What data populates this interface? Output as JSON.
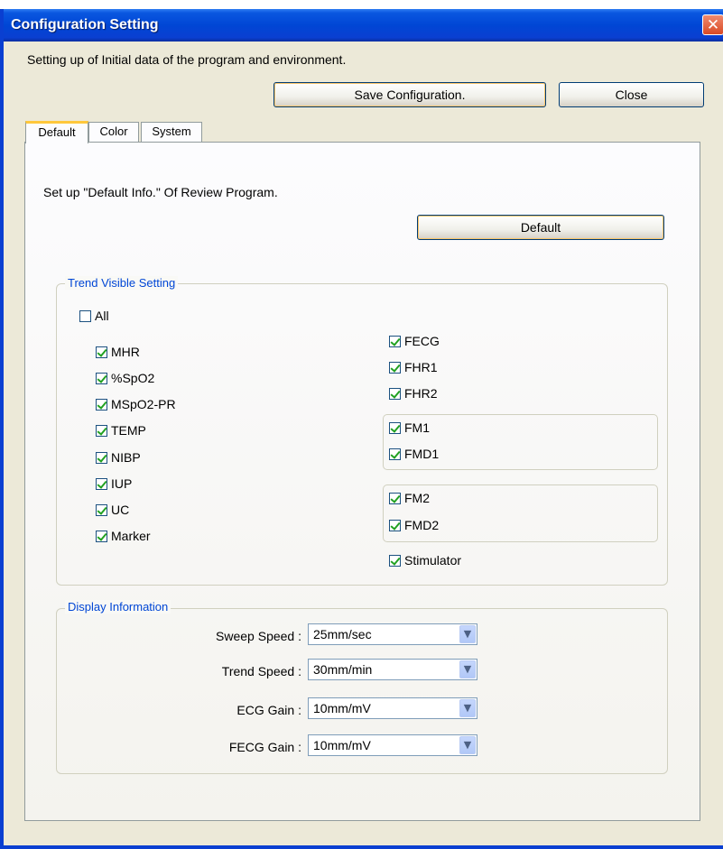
{
  "window": {
    "title": "Configuration Setting",
    "close_glyph": "✕"
  },
  "header": {
    "description": "Setting up of Initial data of the program and environment.",
    "save_label": "Save Configuration.",
    "close_label": "Close"
  },
  "tabs": [
    {
      "label": "Default",
      "selected": true
    },
    {
      "label": "Color",
      "selected": false
    },
    {
      "label": "System",
      "selected": false
    }
  ],
  "panel": {
    "description": "Set up \"Default Info.\" Of Review Program.",
    "default_button": "Default"
  },
  "trend": {
    "title": "Trend Visible Setting",
    "all": {
      "label": "All",
      "checked": false
    },
    "left": [
      {
        "label": "MHR",
        "checked": true
      },
      {
        "label": "%SpO2",
        "checked": true
      },
      {
        "label": "MSpO2-PR",
        "checked": true
      },
      {
        "label": "TEMP",
        "checked": true
      },
      {
        "label": "NIBP",
        "checked": true
      },
      {
        "label": "IUP",
        "checked": true
      },
      {
        "label": "UC",
        "checked": true
      },
      {
        "label": "Marker",
        "checked": true
      }
    ],
    "right": [
      {
        "label": "FECG",
        "checked": true
      },
      {
        "label": "FHR1",
        "checked": true
      },
      {
        "label": "FHR2",
        "checked": true
      }
    ],
    "fm_group1": [
      {
        "label": "FM1",
        "checked": true
      },
      {
        "label": "FMD1",
        "checked": true
      }
    ],
    "fm_group2": [
      {
        "label": "FM2",
        "checked": true
      },
      {
        "label": "FMD2",
        "checked": true
      }
    ],
    "stimulator": {
      "label": "Stimulator",
      "checked": true
    }
  },
  "display": {
    "title": "Display Information",
    "fields": [
      {
        "label": "Sweep Speed :",
        "value": "25mm/sec"
      },
      {
        "label": "Trend Speed :",
        "value": "30mm/min"
      },
      {
        "label": "ECG Gain :",
        "value": "10mm/mV"
      },
      {
        "label": "FECG Gain :",
        "value": "10mm/mV"
      }
    ]
  },
  "colors": {
    "titlebar": "#0046d5",
    "group_label": "#0046d5",
    "check": "#21a121",
    "tab_highlight": "#ffc83c"
  }
}
